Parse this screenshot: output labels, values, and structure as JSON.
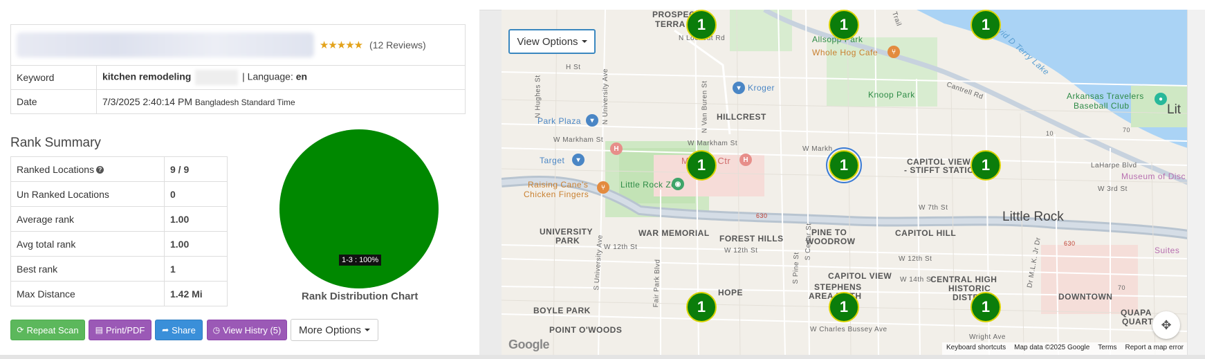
{
  "report": {
    "rating_stars": "★★★★★",
    "reviews": "(12 Reviews)",
    "keyword_label": "Keyword",
    "keyword_value": "kitchen remodeling",
    "language_sep": "| Language:",
    "language_value": "en",
    "date_label": "Date",
    "date_value": "7/3/2025 2:40:14 PM",
    "timezone": "Bangladesh Standard Time"
  },
  "rank_summary": {
    "title": "Rank Summary",
    "rows": [
      {
        "label": "Ranked Locations",
        "value": "9 / 9"
      },
      {
        "label": "Un Ranked Locations",
        "value": "0"
      },
      {
        "label": "Average rank",
        "value": "1.00"
      },
      {
        "label": "Avg total rank",
        "value": "1.00"
      },
      {
        "label": "Best rank",
        "value": "1"
      },
      {
        "label": "Max Distance",
        "value": "1.42 Mi"
      }
    ]
  },
  "chart_data": {
    "type": "pie",
    "title": "Rank Distribution Chart",
    "slices": [
      {
        "label": "1-3 : 100%",
        "value": 100,
        "color": "#008800"
      }
    ]
  },
  "actions": {
    "repeat_scan": "Repeat Scan",
    "print_pdf": "Print/PDF",
    "share": "Share",
    "view_history": "View Histry (5)",
    "more_options": "More Options"
  },
  "map": {
    "view_options": "View Options",
    "marker_rank": "1",
    "markers": [
      {
        "row": 0,
        "col": 0,
        "rank": "1"
      },
      {
        "row": 0,
        "col": 1,
        "rank": "1"
      },
      {
        "row": 0,
        "col": 2,
        "rank": "1"
      },
      {
        "row": 1,
        "col": 0,
        "rank": "1"
      },
      {
        "row": 1,
        "col": 1,
        "rank": "1",
        "selected": true
      },
      {
        "row": 1,
        "col": 2,
        "rank": "1"
      },
      {
        "row": 2,
        "col": 0,
        "rank": "1"
      },
      {
        "row": 2,
        "col": 1,
        "rank": "1"
      },
      {
        "row": 2,
        "col": 2,
        "rank": "1"
      }
    ],
    "labels": {
      "prospect": "PROSPECT",
      "terrace": "TERRA",
      "hillcrest": "HILLCREST",
      "university_park_1": "UNIVERSITY",
      "university_park_2": "PARK",
      "war_memorial": "WAR MEMORIAL",
      "forest_hills": "FOREST HILLS",
      "pine_to_1": "PINE TO",
      "pine_to_2": "WOODROW",
      "capitol_hill": "CAPITOL HILL",
      "capitol_view_1": "CAPITOL VIEW",
      "capitol_view_2": "- STIFFT STATION",
      "capitol_view_s": "CAPITOL VIEW",
      "stephens_1": "STEPHENS",
      "stephens_2": "AREA FAITH",
      "hope": "HOPE",
      "boyle_park": "BOYLE PARK",
      "point_owoods": "POINT O'WOODS",
      "central_high_1": "CENTRAL HIGH",
      "central_high_2": "HISTORIC",
      "central_high_3": "DISTRI",
      "downtown": "DOWNTOWN",
      "quapaw_1": "QUAPA",
      "quapaw_2": "QUART",
      "little_rock": "Little Rock",
      "lit": "Lit",
      "allsopp": "Allsopp Park",
      "whole_hog": "Whole Hog Cafe",
      "kroger": "Kroger",
      "knoop": "Knoop Park",
      "park_plaza": "Park Plaza",
      "target": "Target",
      "medical": "Medical Ctr",
      "raising_1": "Raising Cane's",
      "raising_2": "Chicken Fingers",
      "zoo": "Little Rock Zoo",
      "travelers_1": "Arkansas Travelers",
      "travelers_2": "Baseball Club",
      "lake": "David D Terry Lake",
      "museum": "Museum of Disc",
      "suites": "Suites",
      "h_st": "H St",
      "n_lookout": "N Lookout Rd",
      "cantrell": "Cantrell Rd",
      "w_markham": "W Markham St",
      "w_markham_2": "W Markham St",
      "w_markham_3": "W Markh",
      "w_12th": "W 12th St",
      "w_12th_2": "W 12th St",
      "w_12th_3": "W 12th St",
      "w_7th": "W 7th St",
      "w_14th": "W 14th St",
      "w_charles": "W Charles Bussey Ave",
      "lafayette": "LaHarpe Blvd",
      "w_3rd": "W 3rd St",
      "wright": "Wright Ave",
      "mlk": "Dr M.L.K. Jr Dr",
      "n_university": "N University Ave",
      "s_university": "S University Ave",
      "fair_park": "Fair Park Blvd",
      "n_van_buren": "N Van Buren St",
      "s_cedar": "S Cedar St",
      "s_pine": "S Pine St",
      "n_hughes": "N Hughes St",
      "trail": "Trail",
      "i630": "630",
      "i630_2": "630",
      "r10": "10",
      "r70": "70",
      "r70_2": "70"
    },
    "footer": {
      "shortcuts": "Keyboard shortcuts",
      "map_data": "Map data ©2025 Google",
      "terms": "Terms",
      "report": "Report a map error"
    },
    "google": "Google"
  }
}
